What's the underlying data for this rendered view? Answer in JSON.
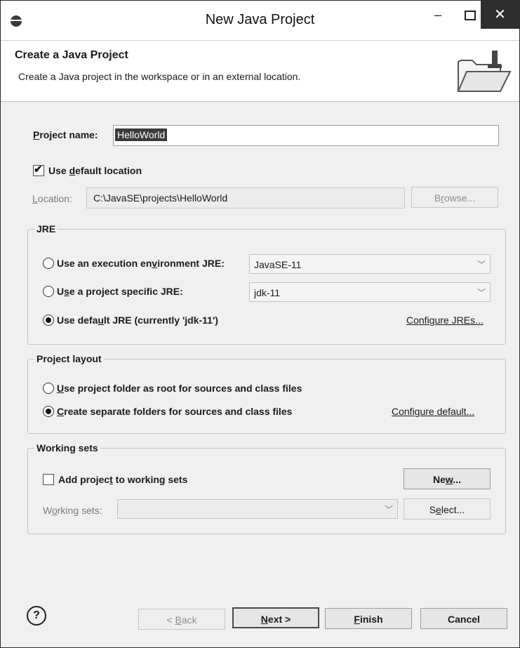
{
  "window": {
    "title": "New Java Project",
    "minimize": "–",
    "close": "✕"
  },
  "banner": {
    "title": "Create a Java Project",
    "description": "Create a Java project in the workspace or in an external location."
  },
  "project": {
    "name_label": "Project name:",
    "name_value": "HelloWorld",
    "use_default_location_label": "Use default location",
    "use_default_location_checked": true,
    "location_label": "Location:",
    "location_value": "C:\\JavaSE\\projects\\HelloWorld",
    "browse_label": "Browse..."
  },
  "jre": {
    "group_label": "JRE",
    "exec_env_label": "Use an execution environment JRE:",
    "exec_env_value": "JavaSE-11",
    "project_specific_label": "Use a project specific JRE:",
    "project_specific_value": "jdk-11",
    "default_label": "Use default JRE (currently 'jdk-11')",
    "configure_link": "Configure JREs...",
    "selected": "default"
  },
  "layout": {
    "group_label": "Project layout",
    "root_label": "Use project folder as root for sources and class files",
    "separate_label": "Create separate folders for sources and class files",
    "configure_link": "Configure default...",
    "selected": "separate"
  },
  "working_sets": {
    "group_label": "Working sets",
    "add_label": "Add project to working sets",
    "add_checked": false,
    "new_button": "New...",
    "field_label": "Working sets:",
    "field_value": "",
    "select_button": "Select..."
  },
  "footer": {
    "help_icon": "?",
    "back_button": "< Back",
    "next_button": "Next >",
    "finish_button": "Finish",
    "cancel_button": "Cancel"
  },
  "icons": {
    "app": "eclipse-icon",
    "banner": "new-folder-wizard-icon",
    "help": "help-icon"
  }
}
